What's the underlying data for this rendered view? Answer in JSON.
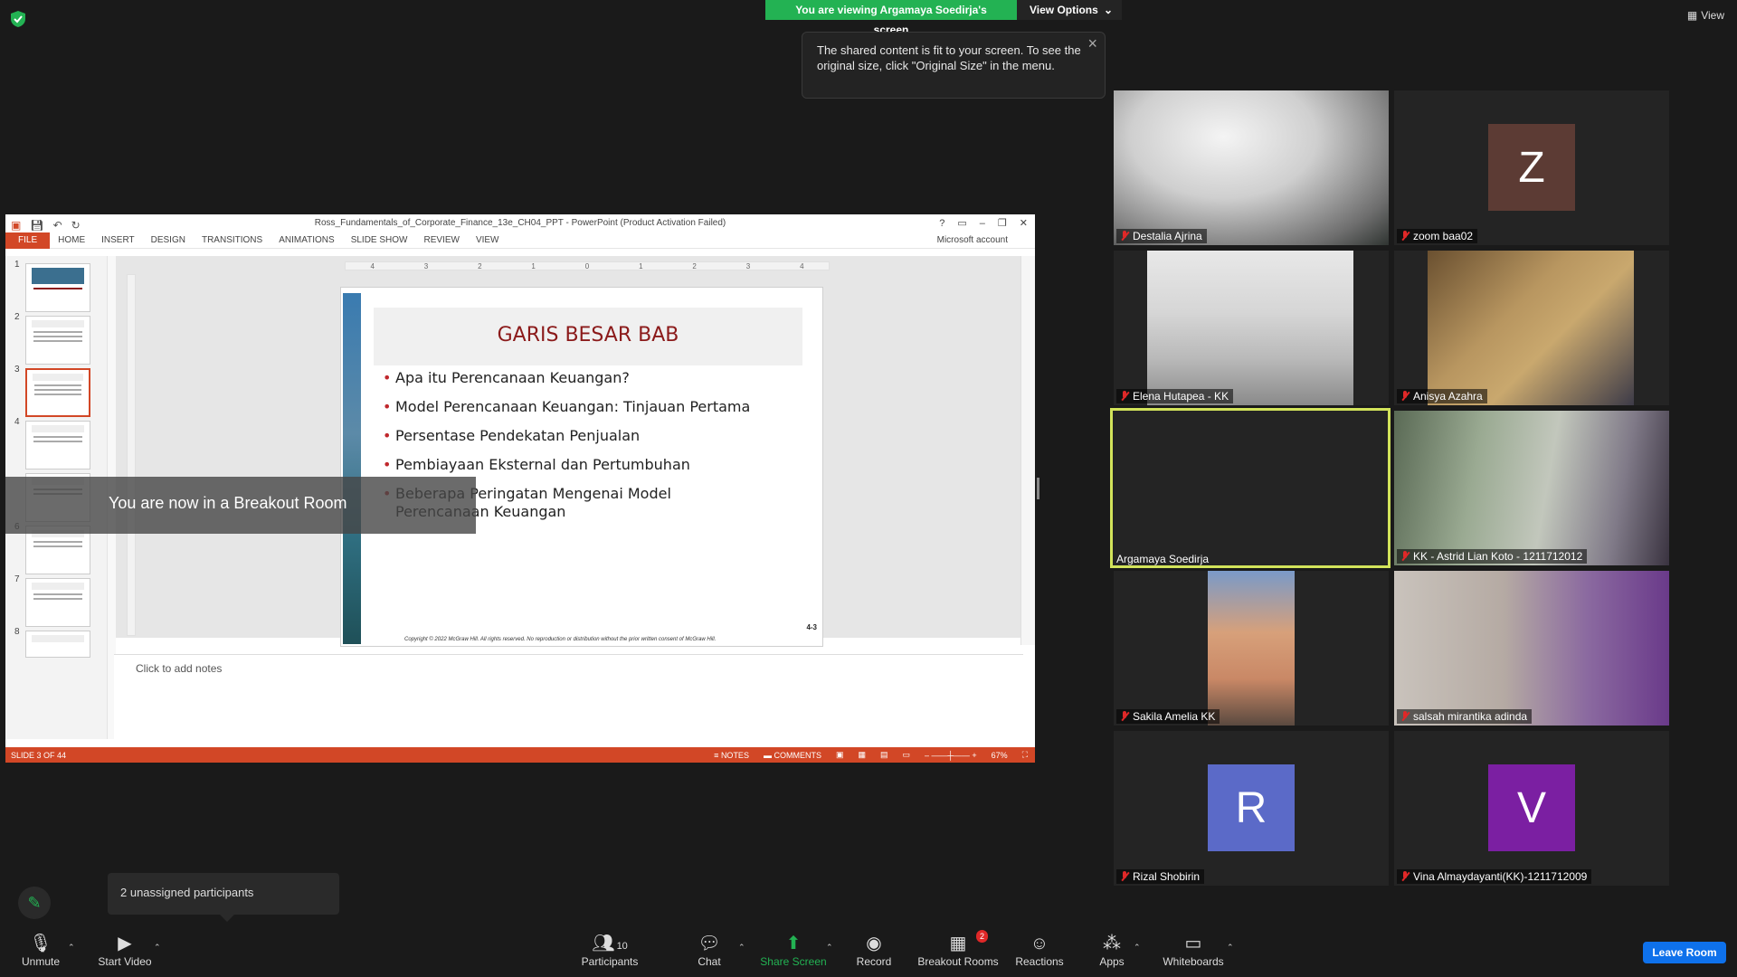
{
  "banner": {
    "viewing": "You are viewing Argamaya Soedirja's screen",
    "view_options": "View Options",
    "view_top": "View"
  },
  "tooltip": {
    "text": "The shared content is fit to your screen. To see the original size, click \"Original Size\" in the menu."
  },
  "ppt": {
    "title": "Ross_Fundamentals_of_Corporate_Finance_13e_CH04_PPT - PowerPoint (Product Activation Failed)",
    "tabs": [
      "FILE",
      "HOME",
      "INSERT",
      "DESIGN",
      "TRANSITIONS",
      "ANIMATIONS",
      "SLIDE SHOW",
      "REVIEW",
      "VIEW"
    ],
    "account": "Microsoft account",
    "ruler": [
      "4",
      "3",
      "2",
      "1",
      "0",
      "1",
      "2",
      "3",
      "4"
    ],
    "thumb_numbers": [
      "1",
      "2",
      "3",
      "4",
      "6",
      "7",
      "8"
    ],
    "slide": {
      "title": "GARIS BESAR BAB",
      "bullets": [
        "Apa itu Perencanaan Keuangan?",
        "Model Perencanaan Keuangan: Tinjauan Pertama",
        "Persentase Pendekatan Penjualan",
        "Pembiayaan Eksternal dan Pertumbuhan",
        "Beberapa Peringatan Mengenai Model Perencanaan Keuangan"
      ],
      "page": "4-3",
      "copyright": "Copyright © 2022 McGraw Hill. All rights reserved. No reproduction or distribution without the prior written consent of McGraw Hill."
    },
    "notes_placeholder": "Click to add notes",
    "status": {
      "slide": "SLIDE 3 OF 44",
      "notes": "NOTES",
      "comments": "COMMENTS",
      "zoom": "67%"
    }
  },
  "breakout_banner": "You are now in a Breakout Room",
  "participants": [
    {
      "name": "Destalia Ajrina",
      "muted": true
    },
    {
      "name": "zoom baa02",
      "muted": true,
      "initial": "Z",
      "color": "#5c3b34"
    },
    {
      "name": "Elena Hutapea - KK",
      "muted": true
    },
    {
      "name": "Anisya Azahra",
      "muted": true
    },
    {
      "name": "Argamaya Soedirja",
      "muted": false
    },
    {
      "name": "KK - Astrid Lian Koto - 1211712012",
      "muted": true
    },
    {
      "name": "Sakila Amelia KK",
      "muted": true
    },
    {
      "name": "salsah mirantika adinda",
      "muted": true
    },
    {
      "name": "Rizal Shobirin",
      "muted": true,
      "initial": "R",
      "color": "#5b6ac8"
    },
    {
      "name": "Vina Almaydayanti(KK)-1211712009",
      "muted": true,
      "initial": "V",
      "color": "#7b1fa2"
    }
  ],
  "unassigned": "2 unassigned participants",
  "toolbar": {
    "unmute": "Unmute",
    "start_video": "Start Video",
    "participants": "Participants",
    "participants_count": "10",
    "chat": "Chat",
    "share_screen": "Share Screen",
    "record": "Record",
    "breakout_rooms": "Breakout Rooms",
    "breakout_badge": "2",
    "reactions": "Reactions",
    "apps": "Apps",
    "whiteboards": "Whiteboards",
    "leave": "Leave Room"
  }
}
